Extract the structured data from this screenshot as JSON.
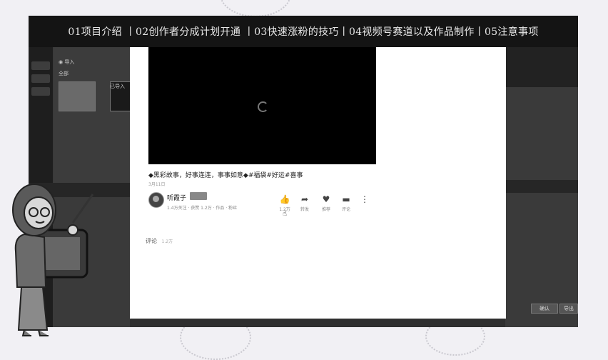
{
  "banner": {
    "text": "01项目介绍  丨02创作者分成计划开通  丨03快速涨粉的技巧丨04视频号赛道以及作品制作丨05注意事项"
  },
  "left_app": {
    "nav": [
      "",
      "",
      ""
    ],
    "panel_title": "◉ 导入",
    "section_label": "全部",
    "thumb_caption": "已导入"
  },
  "video": {
    "state": "loading"
  },
  "post": {
    "title": "◆黑彩故事，好事连连，事事如意◆#福袋#好运#喜事",
    "date": "3月11日",
    "author": "听霞子",
    "meta": "1.4万关注 · 获赞 1.2万 · 作品 · 粉丝"
  },
  "actions": [
    {
      "icon": "thumbs-up-icon",
      "glyph": "👍",
      "label": "1.2万"
    },
    {
      "icon": "share-icon",
      "glyph": "➦",
      "label": "转发"
    },
    {
      "icon": "heart-icon",
      "glyph": "♥",
      "label": "推荐"
    },
    {
      "icon": "comment-icon",
      "glyph": "▬",
      "label": "评论"
    },
    {
      "icon": "more-icon",
      "glyph": "⋮",
      "label": ""
    }
  ],
  "comments": {
    "label": "评论",
    "count": "1.2万"
  },
  "right_app": {
    "btn1": "确认",
    "btn2": "导出"
  },
  "colors": {
    "banner_bg": "#141414",
    "banner_text": "#e8e8e8",
    "page_bg": "#ffffff",
    "frame_bg": "#2f2f2f"
  }
}
